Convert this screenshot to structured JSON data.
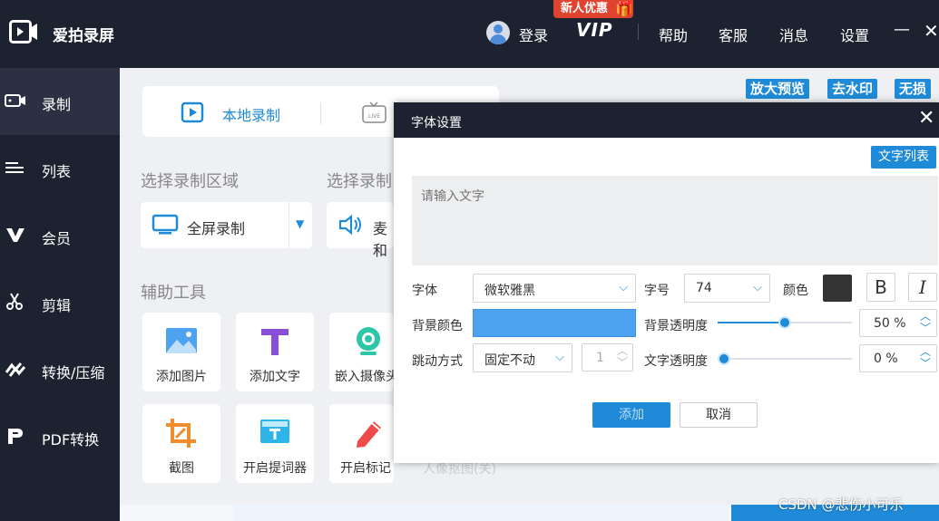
{
  "app": {
    "title": "爱拍录屏",
    "login": "登录",
    "new_user_badge": "新人优惠",
    "vip": "VIP",
    "nav": [
      "帮助",
      "客服",
      "消息",
      "设置"
    ],
    "minimize": "—",
    "close": "✕"
  },
  "sidebar": {
    "items": [
      {
        "label": "录制",
        "icon": "record-icon"
      },
      {
        "label": "列表",
        "icon": "list-icon"
      },
      {
        "label": "会员",
        "icon": "vip-icon"
      },
      {
        "label": "剪辑",
        "icon": "scissors-icon"
      },
      {
        "label": "转换/压缩",
        "icon": "convert-icon"
      },
      {
        "label": "PDF转换",
        "icon": "pdf-icon"
      }
    ]
  },
  "main": {
    "top_buttons": [
      "放大预览",
      "去水印",
      "无损"
    ],
    "mode_local": "本地录制",
    "section_area": "选择录制区域",
    "section_audio": "选择录制",
    "area_value": "全屏录制",
    "audio_value": "麦和",
    "section_tools": "辅助工具",
    "tools": [
      {
        "label": "添加图片",
        "icon": "image-icon"
      },
      {
        "label": "添加文字",
        "icon": "text-icon"
      },
      {
        "label": "嵌入摄像头",
        "icon": "camera-icon"
      },
      {
        "label": "截图",
        "icon": "crop-icon"
      },
      {
        "label": "开启提词器",
        "icon": "teleprompter-icon"
      },
      {
        "label": "开启标记",
        "icon": "marker-icon"
      }
    ],
    "portrait_cutout": "人像抠图(关)"
  },
  "dialog": {
    "title": "字体设置",
    "text_list": "文字列表",
    "text_placeholder": "请输入文字",
    "font_label": "字体",
    "font_value": "微软雅黑",
    "size_label": "字号",
    "size_value": "74",
    "color_label": "颜色",
    "bold": "B",
    "italic": "I",
    "bg_color_label": "背景颜色",
    "bg_color": "#4da3f0",
    "bg_opacity_label": "背景透明度",
    "bg_opacity_value": "50 %",
    "bg_opacity": 0.5,
    "jump_label": "跳动方式",
    "jump_value": "固定不动",
    "jump_num": "1",
    "text_opacity_label": "文字透明度",
    "text_opacity_value": "0 %",
    "text_opacity": 0,
    "add": "添加",
    "cancel": "取消"
  },
  "watermark": "CSDN @悲伤小可乐"
}
